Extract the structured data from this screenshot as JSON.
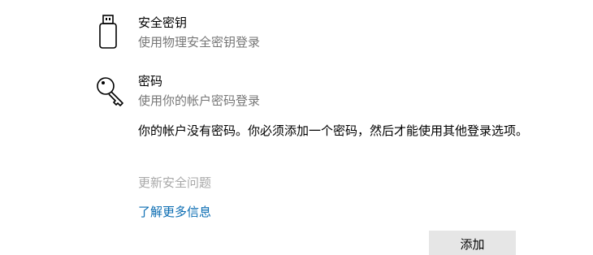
{
  "security_key": {
    "title": "安全密钥",
    "subtitle": "使用物理安全密钥登录",
    "icon": "usb-key-icon"
  },
  "password": {
    "title": "密码",
    "subtitle": "使用你的帐户密码登录",
    "icon": "key-icon",
    "description": "你的帐户没有密码。你必须添加一个密码，然后才能使用其他登录选项。",
    "update_security_questions": "更新安全问题",
    "learn_more": "了解更多信息",
    "add_button": "添加"
  },
  "colors": {
    "subtitle": "#767676",
    "disabled": "#a8a8a8",
    "link": "#0a6cb2",
    "button_bg": "#e6e6e6"
  }
}
